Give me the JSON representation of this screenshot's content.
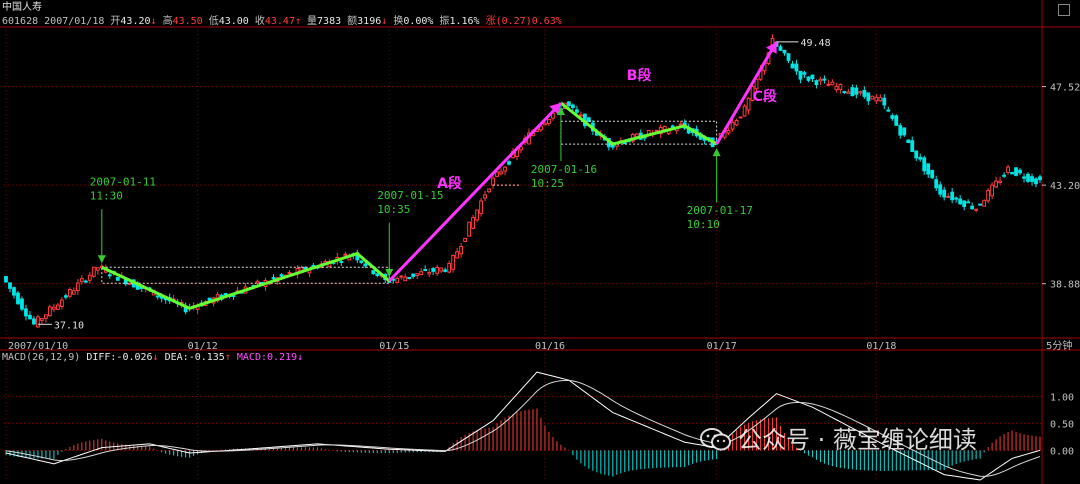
{
  "header": {
    "stock_name": "中国人寿",
    "code": "601628",
    "date": "2007/01/18",
    "open_label": "开",
    "open": "43.20",
    "high_label": "高",
    "high": "43.50",
    "low_label": "低",
    "low": "43.00",
    "close_label": "收",
    "close": "43.47",
    "volume_label": "量",
    "volume": "7383",
    "amount_label": "额",
    "amount": "3196",
    "turnover_label": "换",
    "turnover": "0.00%",
    "amplitude_label": "振",
    "amplitude": "1.16%",
    "change_label": "涨",
    "change": "(0.27)0.63%"
  },
  "macd_header": {
    "name": "MACD(26,12,9)",
    "diff_label": "DIFF:",
    "diff": "-0.026",
    "dea_label": "DEA:",
    "dea": "-0.135",
    "macd_label": "MACD:",
    "macd": "0.219"
  },
  "period": "5分钟",
  "watermark": "公众号 · 薇宝缠论细读",
  "colors": {
    "bg": "#000000",
    "up": "#ff3b3b",
    "down": "#00e5e5",
    "green_line": "#66ff33",
    "magenta": "#ff33ff",
    "annotation": "#33cc33",
    "grid": "#8b0000",
    "axis": "#a00000"
  },
  "chart_data": {
    "type": "candlestick",
    "ylim": [
      36.5,
      50.0
    ],
    "y_ticks": [
      "49.48",
      "47.52",
      "43.20",
      "38.88"
    ],
    "high_label": "49.48",
    "low_label": "37.10",
    "x_ticks": [
      "2007/01/10",
      "01/12",
      "01/15",
      "01/16",
      "01/17",
      "01/18"
    ],
    "x_tick_index": [
      0,
      48,
      96,
      135,
      178,
      218
    ],
    "bar_count": 260,
    "price_path": [
      [
        0,
        39.2
      ],
      [
        8,
        37.1
      ],
      [
        24,
        39.6
      ],
      [
        46,
        37.8
      ],
      [
        88,
        40.2
      ],
      [
        96,
        39.0
      ],
      [
        112,
        39.6
      ],
      [
        122,
        43.2
      ],
      [
        133,
        45.6
      ],
      [
        141,
        46.8
      ],
      [
        152,
        45.0
      ],
      [
        170,
        45.8
      ],
      [
        178,
        45.0
      ],
      [
        186,
        46.5
      ],
      [
        193,
        49.48
      ],
      [
        200,
        48.0
      ],
      [
        220,
        46.9
      ],
      [
        235,
        42.9
      ],
      [
        244,
        42.2
      ],
      [
        252,
        43.9
      ],
      [
        259,
        43.4
      ]
    ],
    "green_pen": [
      [
        24,
        39.6
      ],
      [
        46,
        37.8
      ],
      [
        88,
        40.2
      ],
      [
        96,
        39.0
      ]
    ],
    "green_pen_b": [
      [
        139,
        46.8
      ],
      [
        152,
        45.0
      ],
      [
        170,
        45.8
      ],
      [
        178,
        45.0
      ]
    ],
    "hub_a": {
      "x0": 24,
      "x1": 96,
      "top": 39.6,
      "bottom": 38.9
    },
    "hub_b": {
      "x0": 139,
      "x1": 178,
      "top": 46.0,
      "bottom": 45.0
    },
    "segments": [
      {
        "name": "A段",
        "from": [
          96,
          39.0
        ],
        "to": [
          139,
          46.8
        ]
      },
      {
        "name": "C段",
        "from": [
          178,
          45.0
        ],
        "to": [
          193,
          49.48
        ]
      }
    ],
    "segment_b_label": "B段",
    "annotations": [
      {
        "text1": "2007-01-11",
        "text2": "11:30",
        "x": 24,
        "y": 39.6,
        "dir": "down"
      },
      {
        "text1": "2007-01-15",
        "text2": "10:35",
        "x": 96,
        "y": 39.0,
        "dir": "down"
      },
      {
        "text1": "2007-01-16",
        "text2": "10:25",
        "x": 139,
        "y": 46.8,
        "dir": "up"
      },
      {
        "text1": "2007-01-17",
        "text2": "10:10",
        "x": 178,
        "y": 45.0,
        "dir": "up"
      }
    ],
    "macd_ylim": [
      -0.55,
      1.6
    ],
    "macd_ticks": [
      "1.00",
      "0.50",
      "0.00"
    ],
    "macd_path": [
      [
        0,
        -0.05
      ],
      [
        12,
        -0.25
      ],
      [
        24,
        0.05
      ],
      [
        36,
        0.12
      ],
      [
        46,
        -0.05
      ],
      [
        60,
        0.02
      ],
      [
        78,
        0.12
      ],
      [
        96,
        0.02
      ],
      [
        110,
        -0.02
      ],
      [
        122,
        0.55
      ],
      [
        133,
        1.45
      ],
      [
        141,
        1.3
      ],
      [
        152,
        0.7
      ],
      [
        170,
        0.15
      ],
      [
        178,
        0.05
      ],
      [
        186,
        0.6
      ],
      [
        193,
        1.05
      ],
      [
        202,
        0.8
      ],
      [
        220,
        0.1
      ],
      [
        235,
        -0.45
      ],
      [
        244,
        -0.55
      ],
      [
        252,
        -0.15
      ],
      [
        259,
        0.0
      ]
    ]
  }
}
